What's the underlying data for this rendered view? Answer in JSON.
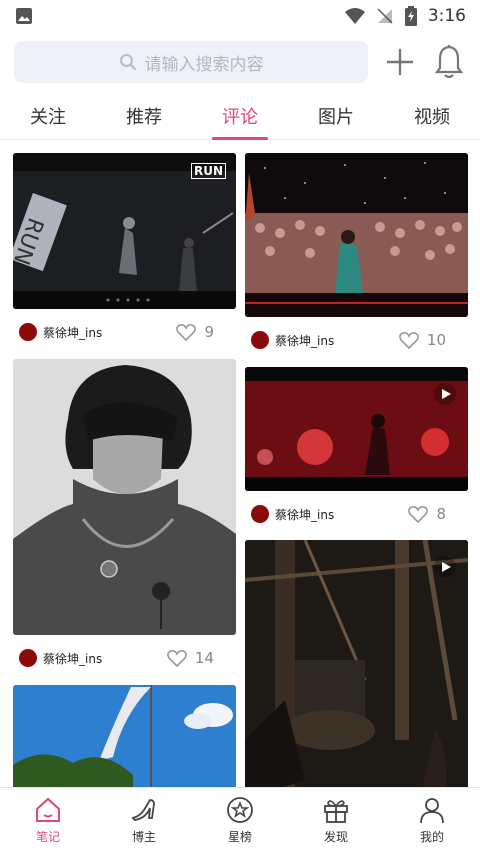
{
  "status_bar": {
    "time": "3:16"
  },
  "search": {
    "placeholder": "请输入搜索内容"
  },
  "tabs": [
    {
      "label": "关注"
    },
    {
      "label": "推荐"
    },
    {
      "label": "评论"
    },
    {
      "label": "图片"
    },
    {
      "label": "视频"
    }
  ],
  "active_tab": "评论",
  "cards": [
    {
      "author": "蔡徐坤_ins",
      "likes": "9",
      "overlay_text": "RUN",
      "type": "video"
    },
    {
      "author": "蔡徐坤_ins",
      "likes": "10",
      "type": "photo"
    },
    {
      "author": "蔡徐坤_ins",
      "likes": "14",
      "type": "photo"
    },
    {
      "author": "蔡徐坤_ins",
      "likes": "8",
      "type": "video"
    },
    {
      "type": "video"
    },
    {
      "type": "photo"
    }
  ],
  "bottom_nav": [
    {
      "label": "笔记"
    },
    {
      "label": "博主"
    },
    {
      "label": "星榜"
    },
    {
      "label": "发现"
    },
    {
      "label": "我的"
    }
  ],
  "colors": {
    "accent": "#e0457b",
    "avatar": "#8b0a0a"
  }
}
